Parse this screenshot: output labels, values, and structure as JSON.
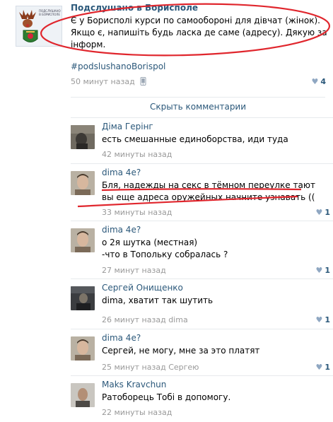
{
  "post": {
    "group_name": "Подслушано в Борисполе",
    "avatar_caption": "ПОДСЛУШАНО В БОРИСПОЛЕ",
    "text_lines": [
      "Є у Борисполі курси по самообороні для дівчат (жінок).",
      "Якщо є, напишіть будь ласка де саме (адресу). Дякую за",
      "інформ."
    ],
    "hashtag": "#podslushanoBorispol",
    "time": "50 минут назад",
    "likes": "4"
  },
  "hide_comments_label": "Скрыть комментарии",
  "comments": [
    {
      "author": "Діма Герінг",
      "lines": [
        "есть смешанные единоборства, иди туда"
      ],
      "time": "42 минуты назад",
      "reply_to": "",
      "likes": ""
    },
    {
      "author": "dima 4e?",
      "lines": [
        "Бля, надежды на секс в тёмном переулке тают",
        "вы еще адреса оружейных начните узнавать (("
      ],
      "time": "33 минуты назад",
      "reply_to": "",
      "likes": "1"
    },
    {
      "author": "dima 4e?",
      "lines": [
        "о 2я шутка (местная)",
        "-что в Топольку собралась ?"
      ],
      "time": "27 минут назад",
      "reply_to": "",
      "likes": "1"
    },
    {
      "author": "Сергей Онищенко",
      "lines": [
        "dima, хватит так шутить"
      ],
      "time": "26 минут назад",
      "reply_to": "dima",
      "likes": "1"
    },
    {
      "author": "dima 4e?",
      "lines": [
        "Сергей, не могу, мне за это платят"
      ],
      "time": "25 минут назад",
      "reply_to": "Сергею",
      "likes": "1"
    },
    {
      "author": "Maks Kravchun",
      "lines": [
        "Ратоборець Тобі в допомогу."
      ],
      "time": "22 минуты назад",
      "reply_to": "",
      "likes": ""
    }
  ],
  "colors": {
    "link": "#2b587a",
    "meta": "#999999",
    "annotation": "#e0262d",
    "like_heart": "#8fa7c2"
  },
  "icons": {
    "phone": "mobile-phone-icon",
    "like": "heart-icon"
  }
}
